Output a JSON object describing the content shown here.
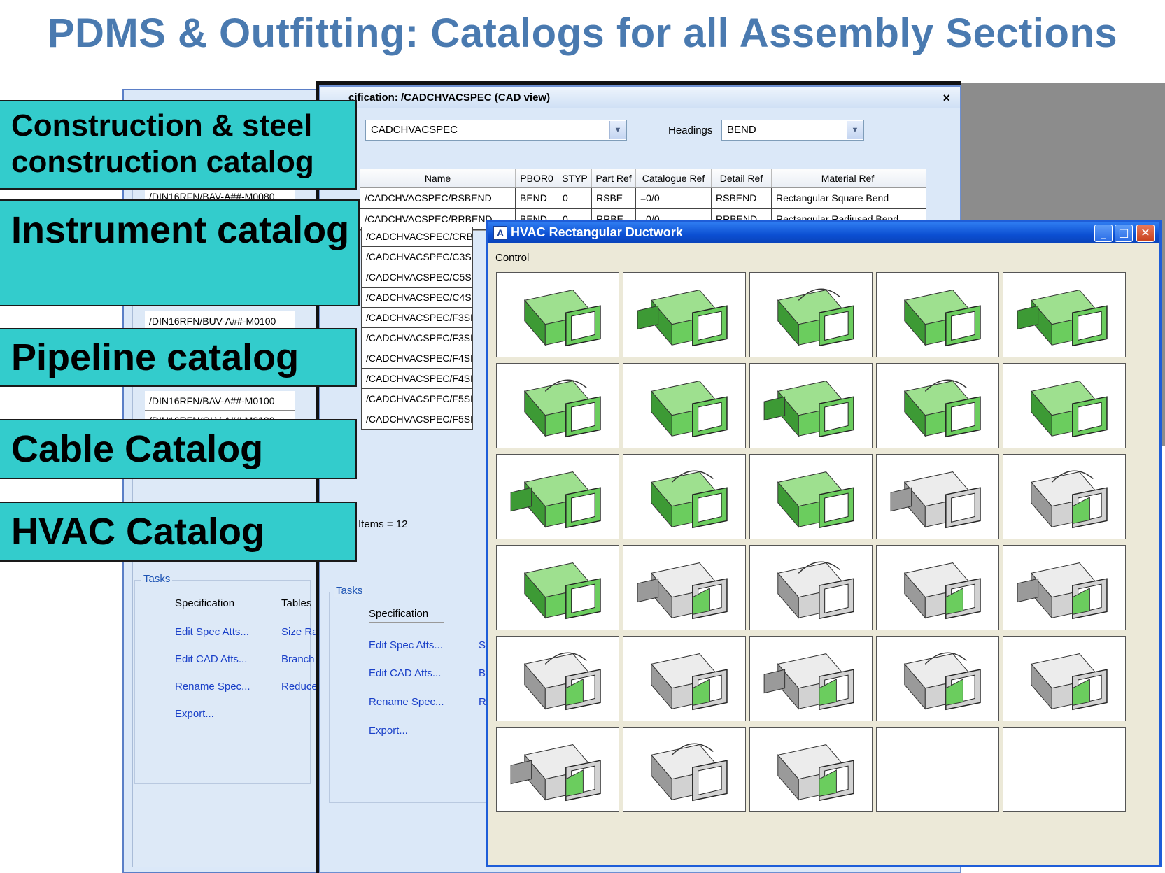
{
  "slide_title": "PDMS & Outfitting: Catalogs for all Assembly Sections",
  "labels": {
    "construction": "Construction & steel construction catalog",
    "instrument": "Instrument catalog",
    "pipeline": "Pipeline catalog",
    "cable": "Cable Catalog",
    "hvac": "HVAC Catalog"
  },
  "back_window": {
    "rows": [
      "/DIN16RFN/BAV-A##-M0080",
      "/DIN16RFN/BUV-A##-M0100",
      "/DIN16RFN/BAV-A##-M0100",
      "/DIN16RFN/GLV-A##-M0100"
    ],
    "tasks_label": "Tasks",
    "col1_header": "Specification",
    "col2_header": "Tables",
    "links": [
      "Edit Spec Atts...",
      "Edit CAD Atts...",
      "Rename Spec...",
      "Export..."
    ],
    "links2": [
      "Size Ra",
      "Branch",
      "Reduce"
    ]
  },
  "spec_window": {
    "title": "cification: /CADCHVACSPEC (CAD view)",
    "close": "×",
    "spec_combo": "CADCHVACSPEC",
    "headings_label": "Headings",
    "headings_combo": "BEND",
    "columns": [
      "Name",
      "PBOR0",
      "STYP",
      "Part Ref",
      "Catalogue Ref",
      "Detail Ref",
      "Material Ref"
    ],
    "rows": [
      [
        "/CADCHVACSPEC/RSBEND",
        "BEND",
        "0",
        "RSBE",
        "=0/0",
        "RSBEND",
        "Rectangular Square Bend"
      ],
      [
        "/CADCHVACSPEC/RRBEND",
        "BEND",
        "0",
        "RRBE",
        "=0/0",
        "RRBEND",
        "Rectangular Radiused Bend"
      ]
    ],
    "more_rows": [
      "/CADCHVACSPEC/CRBI",
      "/CADCHVACSPEC/C3SE",
      "/CADCHVACSPEC/C5SE",
      "/CADCHVACSPEC/C4SE",
      "/CADCHVACSPEC/F3SE",
      "/CADCHVACSPEC/F3SE",
      "/CADCHVACSPEC/F4SE",
      "/CADCHVACSPEC/F4SE",
      "/CADCHVACSPEC/F5SE",
      "/CADCHVACSPEC/F5SE"
    ],
    "items_count": "Items = 12",
    "tasks_label": "Tasks",
    "col1_header": "Specification",
    "links": [
      "Edit Spec Atts...",
      "Edit CAD Atts...",
      "Rename Spec...",
      "Export..."
    ],
    "links2": [
      "S",
      "B",
      "R"
    ]
  },
  "hvac_window": {
    "title": "HVAC Rectangular Ductwork",
    "menu": "Control",
    "tiles": [
      "transition-duct",
      "taper-duct",
      "offset-taper",
      "square-bend",
      "radius-bend",
      "offset-bend",
      "reducer",
      "angled-branch",
      "s-offset",
      "tee-radius",
      "shoe-branch",
      "mitred-branch",
      "straight-branch",
      "plain-duct",
      "access-door",
      "hood",
      "twisted-bend",
      "damper",
      "gray-transition",
      "grille",
      "spigot",
      "splitter",
      "blade-damper",
      "radius-vane",
      "vane-box",
      "fire-damper",
      "flanged-duct",
      "diagonal-transition",
      "empty",
      "empty"
    ]
  },
  "colors": {
    "title_blue": "#4a7ab0",
    "teal": "#33cccc",
    "duct_green": "#6bcd5e",
    "xp_blue": "#1e5dd8"
  }
}
